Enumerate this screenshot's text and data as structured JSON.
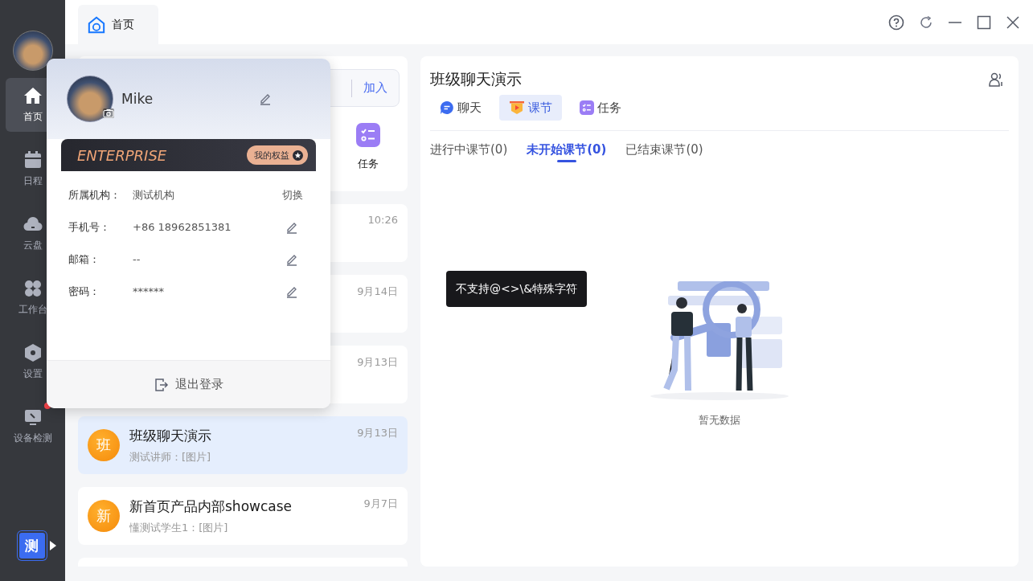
{
  "sidebar": {
    "items": [
      {
        "label": "首页",
        "selected": true,
        "dot": false
      },
      {
        "label": "日程",
        "selected": false,
        "dot": false
      },
      {
        "label": "云盘",
        "selected": false,
        "dot": false
      },
      {
        "label": "工作台",
        "selected": false,
        "dot": false
      },
      {
        "label": "设置",
        "selected": false,
        "dot": false
      },
      {
        "label": "设备检测",
        "selected": false,
        "dot": true
      }
    ],
    "workspace_badge": "测"
  },
  "tabs": [
    {
      "label": "首页",
      "selected": true
    }
  ],
  "middle": {
    "join_button": "加入",
    "quick_actions": [
      {
        "label": "任务"
      }
    ],
    "conversations": [
      {
        "time": "10:26",
        "selected": false
      },
      {
        "time": "9月14日",
        "selected": false
      },
      {
        "time": "9月13日",
        "selected": false
      },
      {
        "avatar": "班",
        "title": "班级聊天演示",
        "preview": "测试讲师：[图片]",
        "time": "9月13日",
        "selected": true
      },
      {
        "avatar": "新",
        "title": "新首页产品内部showcase",
        "preview": "懂测试学生1：[图片]",
        "time": "9月7日",
        "selected": false
      },
      {
        "selected": false
      }
    ]
  },
  "chat_panel": {
    "title": "班级聊天演示",
    "tabs": [
      {
        "label": "聊天",
        "selected": false
      },
      {
        "label": "课节",
        "selected": true
      },
      {
        "label": "任务",
        "selected": false
      }
    ],
    "lesson_tabs": [
      {
        "label": "进行中课节(0)",
        "selected": false
      },
      {
        "label": "未开始课节(0)",
        "selected": true
      },
      {
        "label": "已结束课节(0)",
        "selected": false
      }
    ],
    "empty_text": "暂无数据"
  },
  "tooltip": "不支持@<>\\&特殊字符",
  "profile_popup": {
    "name": "Mike",
    "plan": "ENTERPRISE",
    "benefits_button": "我的权益",
    "fields": [
      {
        "label": "所属机构：",
        "value": "测试机构",
        "action": "切换",
        "kind": "switch"
      },
      {
        "label": "手机号：",
        "value": "+86 18962851381",
        "kind": "edit"
      },
      {
        "label": "邮箱：",
        "value": "--",
        "kind": "edit"
      },
      {
        "label": "密码：",
        "value": "******",
        "kind": "edit"
      }
    ],
    "logout": "退出登录"
  }
}
